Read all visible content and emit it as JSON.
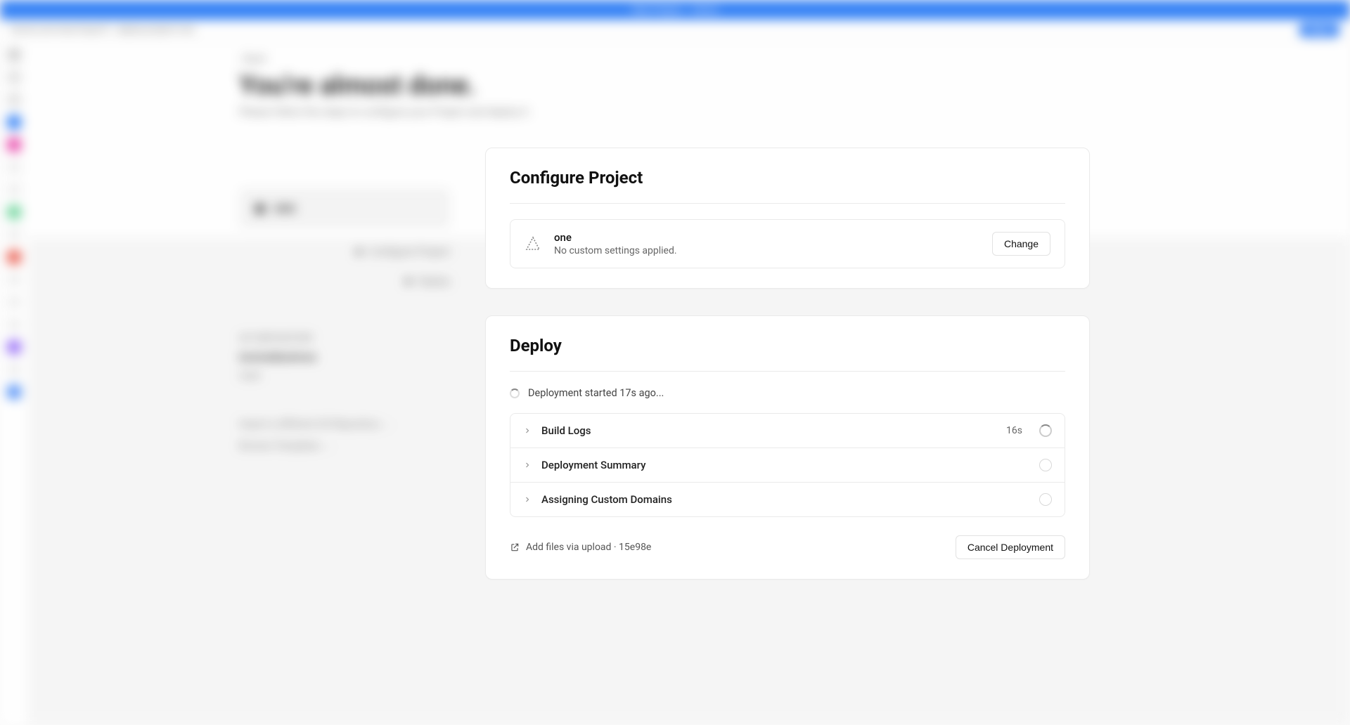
{
  "window": {
    "title": "New Project – Vercel"
  },
  "page": {
    "back": "‹  Back",
    "heading": "You're almost done.",
    "subheading": "Please follow the steps to configure your Project and deploy it."
  },
  "sidebar": {
    "repo_name": "one",
    "steps": [
      {
        "label": "Configure Project"
      },
      {
        "label": "Deploy"
      }
    ],
    "git_repository_label": "GIT REPOSITORY",
    "repo_full": "terminalbashmoe",
    "branch": "main",
    "link_import": "Import a different Git Repository →",
    "link_browse": "Browse Templates →"
  },
  "configure": {
    "title": "Configure Project",
    "project_name": "one",
    "settings_text": "No custom settings applied.",
    "change_button": "Change"
  },
  "deploy": {
    "title": "Deploy",
    "status_text": "Deployment started 17s ago...",
    "rows": [
      {
        "label": "Build Logs",
        "time": "16s",
        "state": "running"
      },
      {
        "label": "Deployment Summary",
        "time": "",
        "state": "pending"
      },
      {
        "label": "Assigning Custom Domains",
        "time": "",
        "state": "pending"
      }
    ],
    "commit_text": "Add files via upload · 15e98e",
    "cancel_button": "Cancel Deployment"
  }
}
